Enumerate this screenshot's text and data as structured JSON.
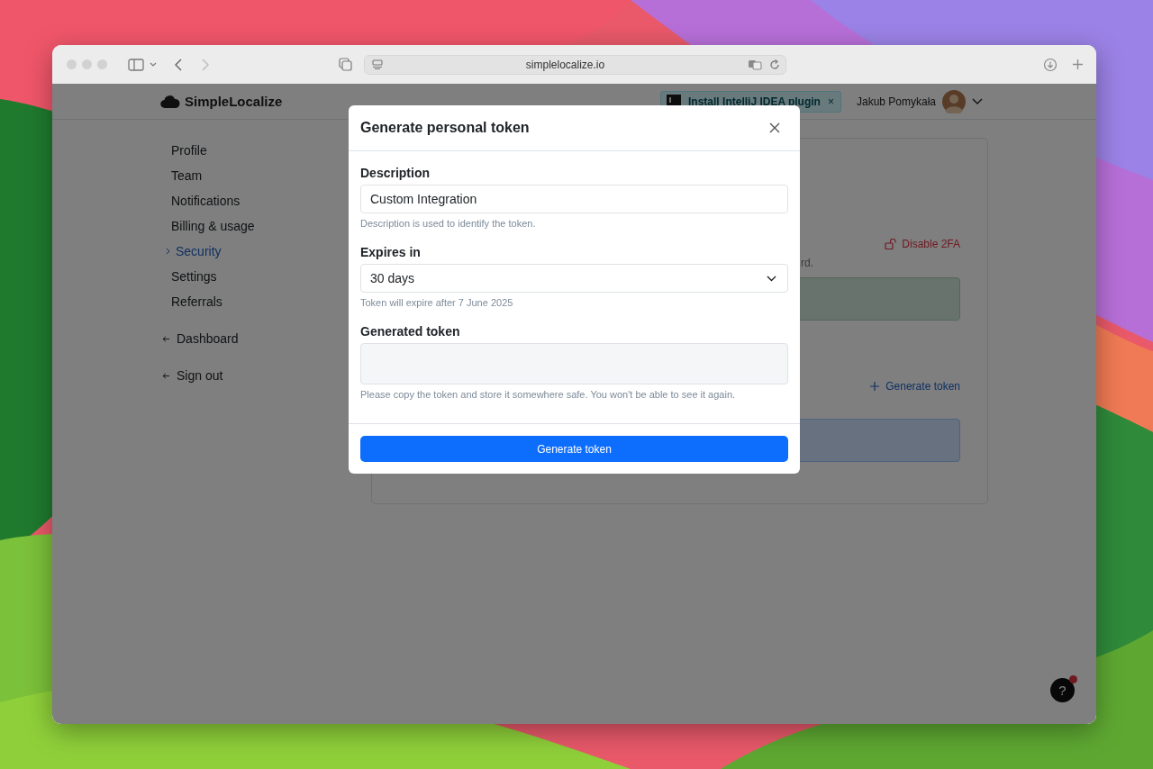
{
  "browser": {
    "url": "simplelocalize.io"
  },
  "header": {
    "logo": "SimpleLocalize",
    "banner": {
      "text": "Install IntelliJ IDEA plugin",
      "close": "×"
    },
    "user": {
      "name": "Jakub Pomykała"
    }
  },
  "sidebar": {
    "items": [
      {
        "label": "Profile",
        "kind": "page",
        "selected": false
      },
      {
        "label": "Team",
        "kind": "page",
        "selected": false
      },
      {
        "label": "Notifications",
        "kind": "page",
        "selected": false
      },
      {
        "label": "Billing & usage",
        "kind": "page",
        "selected": false
      },
      {
        "label": "Security",
        "kind": "page",
        "selected": true
      },
      {
        "label": "Settings",
        "kind": "page",
        "selected": false
      },
      {
        "label": "Referrals",
        "kind": "page",
        "selected": false
      },
      {
        "label": "Dashboard",
        "kind": "back",
        "selected": false
      },
      {
        "label": "Sign out",
        "kind": "back",
        "selected": false
      }
    ]
  },
  "card": {
    "disable_2fa": "Disable 2FA",
    "text_fragment": "rd.",
    "generate_link": "Generate token"
  },
  "modal": {
    "title": "Generate personal token",
    "fields": [
      {
        "kind": "text",
        "label": "Description",
        "value": "Custom Integration",
        "help": "Description is used to identify the token."
      },
      {
        "kind": "select",
        "label": "Expires in",
        "value": "30 days",
        "help": "Token will expire after 7 June 2025"
      },
      {
        "kind": "readonly",
        "label": "Generated token",
        "help": "Please copy the token and store it somewhere safe. You won't be able to see it again."
      }
    ],
    "button": "Generate token"
  },
  "help_button": {
    "label": "?",
    "has_notification": true
  }
}
